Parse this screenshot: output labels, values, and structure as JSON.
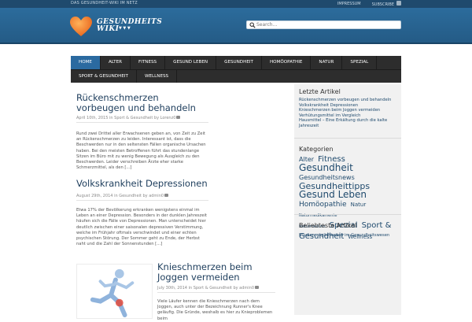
{
  "topbar": {
    "tagline": "DAS GESUNDHEIT-WIKI IM NETZ",
    "links": [
      "IMPRESSUM",
      "SUBSCRIBE"
    ]
  },
  "header": {
    "logo_line1": "GESUNDHEITS",
    "logo_line2": "WIKI",
    "search_placeholder": "Search...",
    "brand_color": "#2c6c9c"
  },
  "nav": {
    "row1": [
      "HOME",
      "ALTER",
      "FITNESS",
      "GESUND LEBEN",
      "GESUNDHEIT",
      "HOMÖOPATHIE",
      "NATUR",
      "SPEZIAL"
    ],
    "row2": [
      "SPORT & GESUNDHEIT",
      "WELLNESS"
    ],
    "active": "HOME"
  },
  "posts": [
    {
      "title": "Rückenschmerzen vorbeugen und behandeln",
      "meta": "April 10th, 2015 in Sport & Gesundheit by Lorenz",
      "comments": "0",
      "excerpt": "Rund zwei Drittel aller Erwachsenen geben an, von Zeit zu Zeit an Rückenschmerzen zu leiden. Interessant ist, dass die Beschwerden nur in den seltensten Fällen organische Ursachen haben. Bei den meisten Betroffenen führt das stundenlange Sitzen im Büro mit zu wenig Bewegung als Ausgleich zu den Beschwerden. Leider verschreiben Ärzte eher starke Schmerzmittel, als den [...]"
    },
    {
      "title": "Volkskrankheit Depressionen",
      "meta": "August 29th, 2014 in Gesundheit by admin",
      "comments": "0",
      "excerpt": "Etwa 17% der Bevölkerung erkranken wenigstens einmal im Leben an einer Depression. Besonders in der dunklen Jahreszeit häufen sich die Fälle von Depressionen. Man unterscheidet hier deutlich zwischen einer saisonalen depressiven Verstimmung, welche im Frühjahr oftmals verschwindet und einer echten psychischen Störung. Der Sommer geht zu Ende, der Herbst naht und die Zahl der Sonnenstunden [...]"
    },
    {
      "title": "Knieschmerzen beim Joggen vermeiden",
      "meta": "July 30th, 2014 in Sport & Gesundheit by admin",
      "comments": "0",
      "excerpt": "Viele Läufer kennen die Knieschmerzen nach dem Joggen, auch unter der Bezeichnung Runner's Knee geläufig. Die Gründe, weshalb es hier zu Knieproblemen beim"
    }
  ],
  "sidebar": {
    "recent_title": "Letzte Artikel",
    "recent": [
      "Rückenschmerzen vorbeugen und behandeln",
      "Volkskrankheit Depressionen",
      "Knieschmerzen beim Joggen vermeiden",
      "Verhütungsmittel im Vergleich",
      "Hausmittel – Eine Erkältung durch die kalte Jahreszeit"
    ],
    "categories_title": "Kategorien",
    "tags": [
      {
        "label": "Alter",
        "size": 8
      },
      {
        "label": "Fitness",
        "size": 10
      },
      {
        "label": "Gesundheit",
        "size": 12
      },
      {
        "label": "Gesundheitsnews",
        "size": 8
      },
      {
        "label": "Gesundheittipps",
        "size": 11
      },
      {
        "label": "Gesund Leben",
        "size": 12
      },
      {
        "label": "Homöopathie",
        "size": 9
      },
      {
        "label": "Natur",
        "size": 7
      },
      {
        "label": "Naturmedikamente",
        "size": 5
      },
      {
        "label": "Naturmedizin",
        "size": 5
      },
      {
        "label": "Spezial",
        "size": 10
      },
      {
        "label": "Sport & Gesundheit",
        "size": 10
      },
      {
        "label": "Wellness",
        "size": 7
      }
    ],
    "popular_title": "Beliebteste Artikel",
    "popular": [
      "Studienmöglichkeiten im Gesundheitswesen"
    ]
  }
}
